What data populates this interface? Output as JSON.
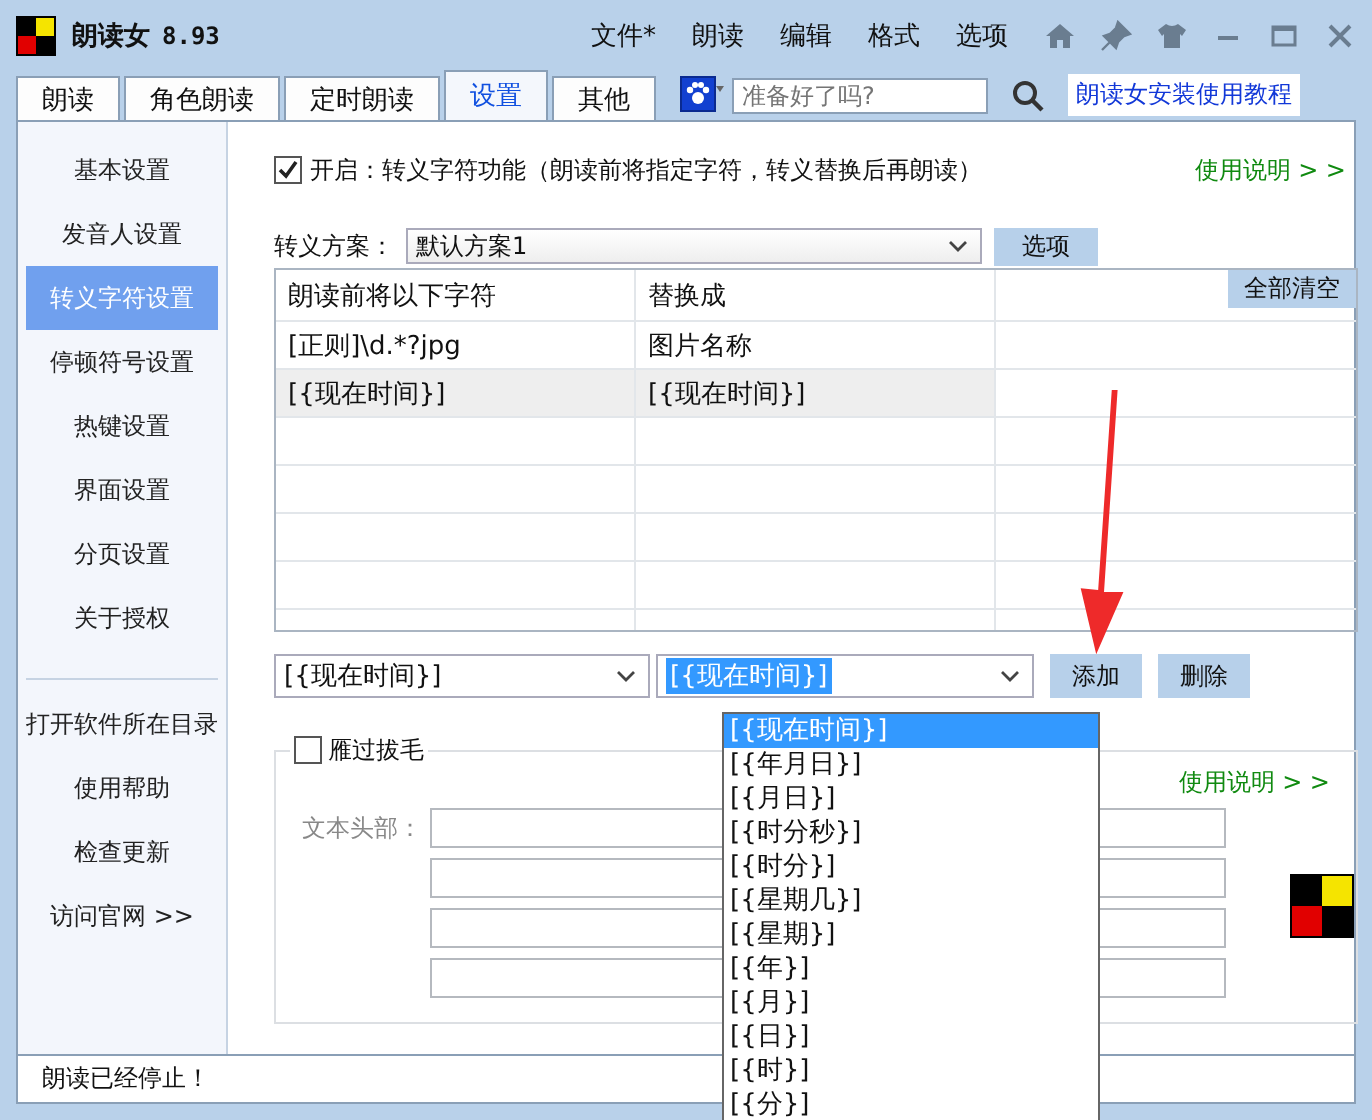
{
  "window": {
    "app_name": "朗读女",
    "version": "8.93"
  },
  "menu": [
    "文件*",
    "朗读",
    "编辑",
    "格式",
    "选项"
  ],
  "tabs": [
    {
      "label": "朗读",
      "selected": false
    },
    {
      "label": "角色朗读",
      "selected": false
    },
    {
      "label": "定时朗读",
      "selected": false
    },
    {
      "label": "设置",
      "selected": true
    },
    {
      "label": "其他",
      "selected": false
    }
  ],
  "search": {
    "placeholder": "准备好了吗?"
  },
  "tutorial_link": "朗读女安装使用教程",
  "sidebar": {
    "items": [
      {
        "label": "基本设置",
        "selected": false
      },
      {
        "label": "发音人设置",
        "selected": false
      },
      {
        "label": "转义字符设置",
        "selected": true
      },
      {
        "label": "停顿符号设置",
        "selected": false
      },
      {
        "label": "热键设置",
        "selected": false
      },
      {
        "label": "界面设置",
        "selected": false
      },
      {
        "label": "分页设置",
        "selected": false
      },
      {
        "label": "关于授权",
        "selected": false
      }
    ],
    "links": [
      "打开软件所在目录",
      "使用帮助",
      "检查更新",
      "访问官网 >>"
    ]
  },
  "feature": {
    "checked": true,
    "label": "开启：转义字符功能（朗读前将指定字符，转义替换后再朗读）",
    "help_link": "使用说明 > >"
  },
  "scheme": {
    "label": "转义方案：",
    "value": "默认方案1",
    "options_button": "选项"
  },
  "table": {
    "columns": [
      "朗读前将以下字符",
      "替换成"
    ],
    "clear_button": "全部清空",
    "rows": [
      {
        "cells": [
          "[正则]\\d.*?jpg",
          "图片名称"
        ],
        "selected": false
      },
      {
        "cells": [
          "[{现在时间}]",
          "[{现在时间}]"
        ],
        "selected": true
      }
    ]
  },
  "editor": {
    "source_value": "[{现在时间}]",
    "target_value": "[{现在时间}]",
    "add_button": "添加",
    "delete_button": "删除",
    "dropdown_items": [
      {
        "label": "[{现在时间}]",
        "selected": true
      },
      {
        "label": "[{年月日}]",
        "selected": false
      },
      {
        "label": "[{月日}]",
        "selected": false
      },
      {
        "label": "[{时分秒}]",
        "selected": false
      },
      {
        "label": "[{时分}]",
        "selected": false
      },
      {
        "label": "[{星期几}]",
        "selected": false
      },
      {
        "label": "[{星期}]",
        "selected": false
      },
      {
        "label": "[{年}]",
        "selected": false
      },
      {
        "label": "[{月}]",
        "selected": false
      },
      {
        "label": "[{日}]",
        "selected": false
      },
      {
        "label": "[{时}]",
        "selected": false
      },
      {
        "label": "[{分}]",
        "selected": false
      }
    ]
  },
  "filter": {
    "checked": false,
    "label": "雁过拔毛",
    "help_link": "使用说明 > >",
    "field_label": "文本头部："
  },
  "status_bar": "朗读已经停止！"
}
